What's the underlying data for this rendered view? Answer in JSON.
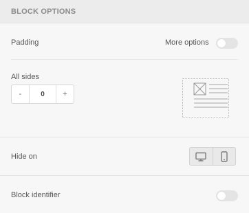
{
  "header": {
    "title": "BLOCK OPTIONS"
  },
  "padding": {
    "label": "Padding",
    "more_options_label": "More options",
    "more_options_on": false,
    "all_sides_label": "All sides",
    "stepper": {
      "minus_label": "-",
      "value": "0",
      "plus_label": "+"
    },
    "preview_icon": "block-layout-preview-icon"
  },
  "hide_on": {
    "label": "Hide on",
    "devices": [
      {
        "icon": "desktop-icon"
      },
      {
        "icon": "mobile-icon"
      }
    ]
  },
  "block_identifier": {
    "label": "Block identifier",
    "enabled": false
  },
  "colors": {
    "header_bg": "#ececec",
    "panel_bg": "#f7f7f7",
    "toggle_off": "#e4e4e4",
    "icon_gray": "#8a8a8a"
  }
}
